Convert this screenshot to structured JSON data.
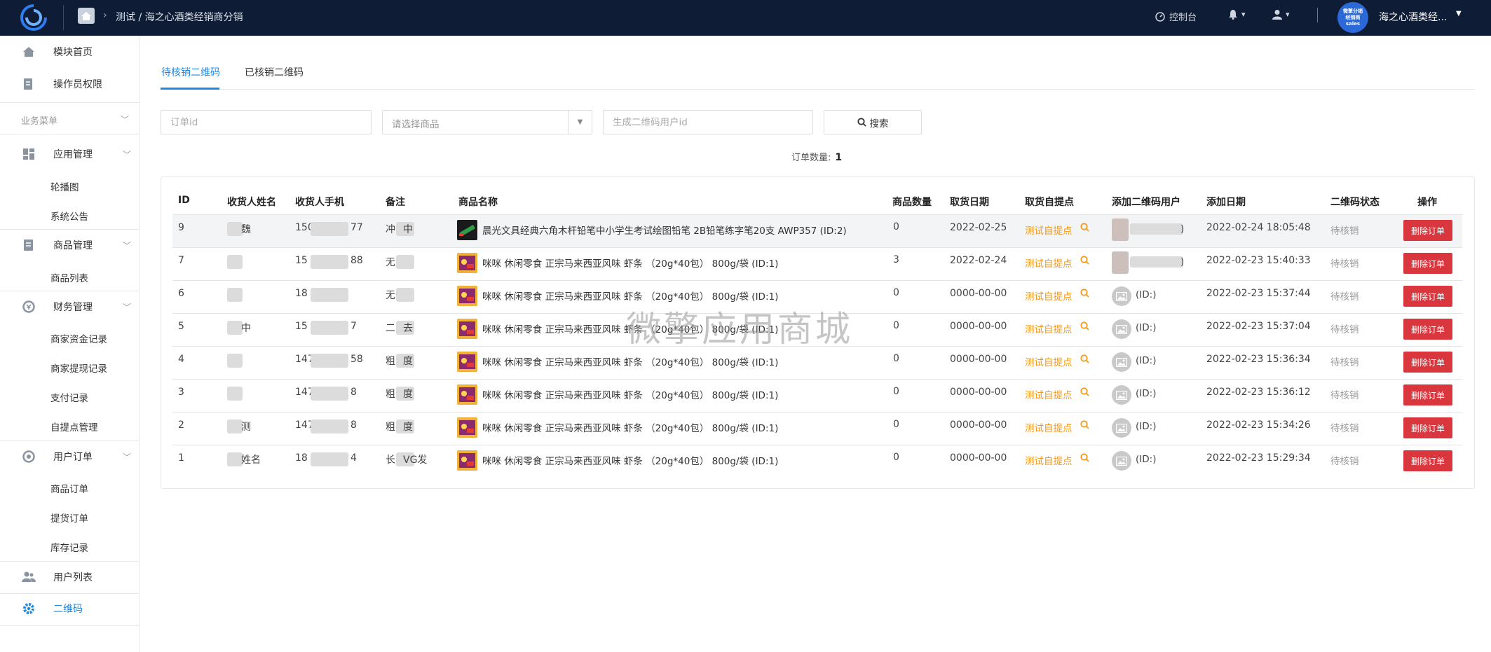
{
  "header": {
    "breadcrumb": "测试 / 海之心酒类经销商分销",
    "console_label": "控制台",
    "avatar_text": [
      "微擎分销",
      "经销商",
      "sales"
    ],
    "shop_name": "海之心酒类经..."
  },
  "sidebar": {
    "top_items": [
      {
        "label": "模块首页",
        "icon": "home-icon"
      },
      {
        "label": "操作员权限",
        "icon": "permission-icon"
      }
    ],
    "group_label": "业务菜单",
    "sections": [
      {
        "label": "应用管理",
        "icon": "apps-icon",
        "children": [
          "轮播图",
          "系统公告"
        ]
      },
      {
        "label": "商品管理",
        "icon": "goods-icon",
        "children": [
          "商品列表"
        ]
      },
      {
        "label": "财务管理",
        "icon": "finance-icon",
        "children": [
          "商家资金记录",
          "商家提现记录",
          "支付记录",
          "自提点管理"
        ]
      },
      {
        "label": "用户订单",
        "icon": "orders-icon",
        "children": [
          "商品订单",
          "提货订单",
          "库存记录"
        ]
      }
    ],
    "bottom_items": [
      {
        "label": "用户列表",
        "icon": "users-icon"
      },
      {
        "label": "二维码",
        "icon": "gear-icon",
        "active": true
      }
    ]
  },
  "tabs": [
    {
      "label": "待核销二维码",
      "active": true
    },
    {
      "label": "已核销二维码",
      "active": false
    }
  ],
  "filters": {
    "order_id_placeholder": "订单id",
    "product_placeholder": "请选择商品",
    "user_id_placeholder": "生成二维码用户id",
    "search_label": "搜索"
  },
  "order_count_label": "订单数量:",
  "order_count": "1",
  "table": {
    "columns": [
      "ID",
      "收货人姓名",
      "收货人手机",
      "备注",
      "商品名称",
      "商品数量",
      "取货日期",
      "取货自提点",
      "添加二维码用户",
      "添加日期",
      "二维码状态",
      "操作"
    ],
    "rows": [
      {
        "id": "9",
        "name": "魏",
        "phone": "150",
        "phone_end": "77",
        "remark": "冲",
        "remark_end": "中",
        "product": "晨光文具经典六角木杆铅笔中小学生考试绘图铅笔 2B铅笔练字笔20支 AWP357 (ID:2)",
        "qty": "0",
        "pick_date": "2022-02-25",
        "pickpoint": "测试自提点",
        "qr_user": ")",
        "qr_user_blurred": true,
        "add_date": "2022-02-24 18:05:48",
        "state": "待核销",
        "action": "删除订单",
        "thumb": "pencil"
      },
      {
        "id": "7",
        "name": "",
        "phone": "15",
        "phone_end": "88",
        "remark": "无",
        "remark_end": "",
        "product": "咪咪 休闲零食 正宗马来西亚风味 虾条 （20g*40包） 800g/袋 (ID:1)",
        "qty": "3",
        "pick_date": "2022-02-24",
        "pickpoint": "测试自提点",
        "qr_user": ")",
        "qr_user_blurred": true,
        "add_date": "2022-02-23 15:40:33",
        "state": "待核销",
        "action": "删除订单",
        "thumb": "snack"
      },
      {
        "id": "6",
        "name": "",
        "phone": "18",
        "phone_end": "",
        "remark": "无",
        "remark_end": "",
        "product": "咪咪 休闲零食 正宗马来西亚风味 虾条 （20g*40包） 800g/袋 (ID:1)",
        "qty": "0",
        "pick_date": "0000-00-00",
        "pickpoint": "测试自提点",
        "qr_user": "(ID:)",
        "qr_user_blurred": false,
        "add_date": "2022-02-23 15:37:44",
        "state": "待核销",
        "action": "删除订单",
        "thumb": "snack"
      },
      {
        "id": "5",
        "name": "中",
        "phone": "15",
        "phone_end": "7",
        "remark": "二",
        "remark_end": "去",
        "product": "咪咪 休闲零食 正宗马来西亚风味 虾条 （20g*40包） 800g/袋 (ID:1)",
        "qty": "0",
        "pick_date": "0000-00-00",
        "pickpoint": "测试自提点",
        "qr_user": "(ID:)",
        "qr_user_blurred": false,
        "add_date": "2022-02-23 15:37:04",
        "state": "待核销",
        "action": "删除订单",
        "thumb": "snack"
      },
      {
        "id": "4",
        "name": "",
        "phone": "147",
        "phone_end": "58",
        "remark": "粗",
        "remark_end": "度",
        "product": "咪咪 休闲零食 正宗马来西亚风味 虾条 （20g*40包） 800g/袋 (ID:1)",
        "qty": "0",
        "pick_date": "0000-00-00",
        "pickpoint": "测试自提点",
        "qr_user": "(ID:)",
        "qr_user_blurred": false,
        "add_date": "2022-02-23 15:36:34",
        "state": "待核销",
        "action": "删除订单",
        "thumb": "snack"
      },
      {
        "id": "3",
        "name": "",
        "phone": "147",
        "phone_end": "8",
        "remark": "粗",
        "remark_end": "度",
        "product": "咪咪 休闲零食 正宗马来西亚风味 虾条 （20g*40包） 800g/袋 (ID:1)",
        "qty": "0",
        "pick_date": "0000-00-00",
        "pickpoint": "测试自提点",
        "qr_user": "(ID:)",
        "qr_user_blurred": false,
        "add_date": "2022-02-23 15:36:12",
        "state": "待核销",
        "action": "删除订单",
        "thumb": "snack"
      },
      {
        "id": "2",
        "name": "测",
        "phone": "147",
        "phone_end": "8",
        "remark": "粗",
        "remark_end": "度",
        "product": "咪咪 休闲零食 正宗马来西亚风味 虾条 （20g*40包） 800g/袋 (ID:1)",
        "qty": "0",
        "pick_date": "0000-00-00",
        "pickpoint": "测试自提点",
        "qr_user": "(ID:)",
        "qr_user_blurred": false,
        "add_date": "2022-02-23 15:34:26",
        "state": "待核销",
        "action": "删除订单",
        "thumb": "snack"
      },
      {
        "id": "1",
        "name": "姓名",
        "phone": "18",
        "phone_end": "4",
        "remark": "长",
        "remark_end": "VG发",
        "product": "咪咪 休闲零食 正宗马来西亚风味 虾条 （20g*40包） 800g/袋 (ID:1)",
        "qty": "0",
        "pick_date": "0000-00-00",
        "pickpoint": "测试自提点",
        "qr_user": "(ID:)",
        "qr_user_blurred": false,
        "add_date": "2022-02-23 15:29:34",
        "state": "待核销",
        "action": "删除订单",
        "thumb": "snack"
      }
    ]
  },
  "watermark": "微擎应用商城",
  "colors": {
    "topbar": "#0f1c35",
    "accent": "#1e88e5",
    "pickpoint": "#f39a1e",
    "danger": "#d9363e"
  }
}
